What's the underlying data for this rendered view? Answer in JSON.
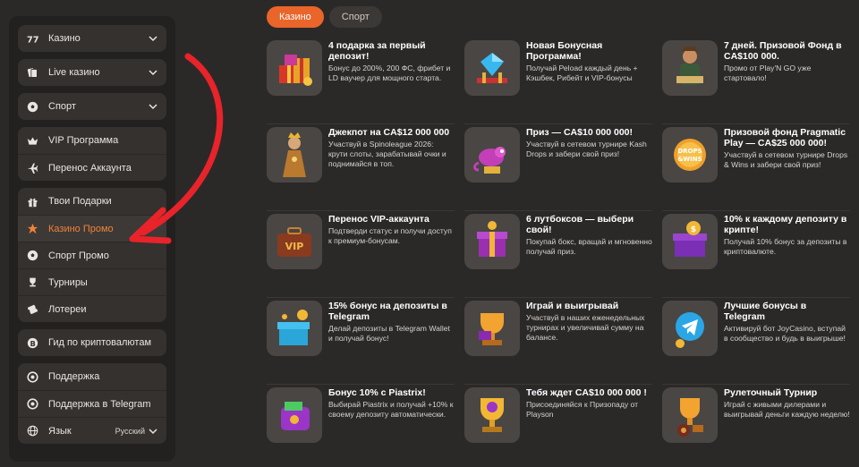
{
  "sidebar": {
    "casino": "Казино",
    "live": "Live казино",
    "sport": "Спорт",
    "vip": "VIP Программа",
    "transfer": "Перенос Аккаунта",
    "gifts": "Твои Подарки",
    "casino_promo": "Казино Промо",
    "sport_promo": "Спорт Промо",
    "tournaments": "Турниры",
    "lotteries": "Лотереи",
    "crypto_guide": "Гид по криптовалютам",
    "support": "Поддержка",
    "support_tg": "Поддержка в Telegram",
    "language_label": "Язык",
    "language_value": "Русский"
  },
  "tabs": {
    "casino": "Казино",
    "sport": "Спорт"
  },
  "accent_color": "#e9652a",
  "promos": [
    {
      "title": "4 подарка за первый депозит!",
      "desc": "Бонус до 200%, 200 ФС, фрибет и LD ваучер для мощного старта.",
      "icon": "gift-boxes-icon"
    },
    {
      "title": "Новая Бонусная Программа!",
      "desc": "Получай Реload каждый день + Кэшбек, Рибейт и VIP-бонусы",
      "icon": "diamond-icon"
    },
    {
      "title": "7 дней. Призовой Фонд в CA$100 000.",
      "desc": "Промо от Play'N GO уже стартовало!",
      "icon": "explorer-icon"
    },
    {
      "title": "Джекпот на CA$12 000 000",
      "desc": "Участвуй в Spinoleague 2026: крути слоты, зарабатывай очки и поднимайся в топ.",
      "icon": "queen-icon"
    },
    {
      "title": "Приз — CA$10 000 000!",
      "desc": "Участвуй в сетевом турнире Kash Drops и забери свой приз!",
      "icon": "chameleon-icon"
    },
    {
      "title": "Призовой фонд Pragmatic Play — CA$25 000 000!",
      "desc": "Участвуй в сетевом турнире Drops & Wins и забери свой приз!",
      "icon": "drops-wins-coin-icon"
    },
    {
      "title": "Перенос VIP-аккаунта",
      "desc": "Подтверди статус и получи доступ к премиум-бонусам.",
      "icon": "vip-suitcase-icon"
    },
    {
      "title": "6 лутбоксов — выбери свой!",
      "desc": "Покупай бокс, вращай и мгновенно получай приз.",
      "icon": "lootbox-icon"
    },
    {
      "title": "10% к каждому депозиту в крипте!",
      "desc": "Получай 10% бонус за депозиты в криптовалюте.",
      "icon": "crypto-gift-icon"
    },
    {
      "title": "15% бонус на депозиты в Telegram",
      "desc": "Делай депозиты в Telegram Wallet и получай бонус!",
      "icon": "telegram-box-icon"
    },
    {
      "title": "Играй и выигрывай",
      "desc": "Участвуй в наших еженедельных турнирах и увеличивай сумму на балансе.",
      "icon": "trophy-icon"
    },
    {
      "title": "Лучшие бонусы в Telegram",
      "desc": "Активируй бот JoyCasino, вступай в сообщество и будь в выигрыше!",
      "icon": "telegram-icon"
    },
    {
      "title": "Бонус 10% с Piastrix!",
      "desc": "Выбирай Piastrix и получай +10% к своему депозиту автоматически.",
      "icon": "wallet-icon"
    },
    {
      "title": "Тебя ждет CA$10 000 000 !",
      "desc": "Присоединяйся к Призопаду от Playson",
      "icon": "gold-trophy-icon"
    },
    {
      "title": "Рулеточный Турнир",
      "desc": "Играй с живыми дилерами и выигрывай деньги каждую неделю!",
      "icon": "roulette-trophy-icon"
    }
  ]
}
